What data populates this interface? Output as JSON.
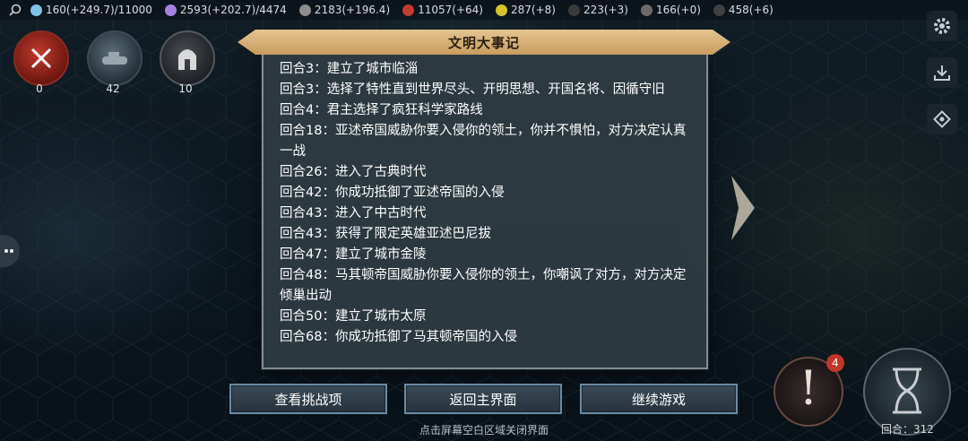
{
  "resources": [
    {
      "icon": "population-icon",
      "text": "160(+249.7)/11000",
      "color": "#7fc3e6"
    },
    {
      "icon": "science-star-icon",
      "text": "2593(+202.7)/4474",
      "color": "#a682e0"
    },
    {
      "icon": "culture-icon",
      "text": "2183(+196.4)",
      "color": "#8c8c8c"
    },
    {
      "icon": "gold-icon",
      "text": "11057(+64)",
      "color": "#c23b2e"
    },
    {
      "icon": "nuclear-icon",
      "text": "287(+8)",
      "color": "#d6c229"
    },
    {
      "icon": "oil-icon",
      "text": "223(+3)",
      "color": "#3a3a3a"
    },
    {
      "icon": "steel-icon",
      "text": "166(+0)",
      "color": "#6a6a6a"
    },
    {
      "icon": "energy-icon",
      "text": "458(+6)",
      "color": "#404040"
    }
  ],
  "units": [
    {
      "count": "0"
    },
    {
      "count": "42"
    },
    {
      "count": "10"
    }
  ],
  "dialog": {
    "title": "文明大事记",
    "entries": [
      "回合3：建立了城市临淄",
      "回合3：选择了特性直到世界尽头、开明思想、开国名将、因循守旧",
      "回合4：君主选择了疯狂科学家路线",
      "回合18：亚述帝国威胁你要入侵你的领土，你并不惧怕，对方决定认真一战",
      "回合26：进入了古典时代",
      "回合42：你成功抵御了亚述帝国的入侵",
      "回合43：进入了中古时代",
      "回合43：获得了限定英雄亚述巴尼拔",
      "回合47：建立了城市金陵",
      "回合48：马其顿帝国威胁你要入侵你的领土，你嘲讽了对方，对方决定倾巢出动",
      "回合50：建立了城市太原",
      "回合68：你成功抵御了马其顿帝国的入侵"
    ]
  },
  "buttons": {
    "challenges": "查看挑战项",
    "main_menu": "返回主界面",
    "continue": "继续游戏"
  },
  "hint": "点击屏幕空白区域关闭界面",
  "alert_badge": "4",
  "turn_label": "回合：312"
}
